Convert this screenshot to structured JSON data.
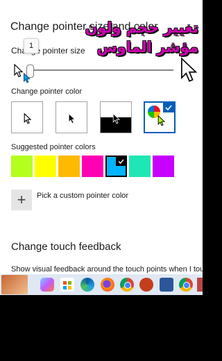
{
  "settings": {
    "heading": "Change pointer size and color",
    "overlay": {
      "line1": "تغيير حجم ولون",
      "line2": "مؤشر الماوس"
    },
    "size": {
      "label": "Change pointer size",
      "tooltip": "1",
      "value": 1,
      "min": 1,
      "max": 15
    },
    "color": {
      "label": "Change pointer color",
      "options": [
        "white",
        "black",
        "inverted",
        "custom"
      ],
      "selected": "custom"
    },
    "suggested": {
      "label": "Suggested pointer colors",
      "colors": [
        "#b4ff1e",
        "#ffff00",
        "#ffb900",
        "#ff00b4",
        "#00b4ff",
        "#1ee6b4",
        "#c800ff"
      ],
      "selected": "#00b4ff"
    },
    "custom": {
      "icon": "plus-icon",
      "glyph": "+",
      "label": "Pick a custom pointer color"
    },
    "touch": {
      "heading": "Change touch feedback",
      "description": "Show visual feedback around the touch points when I touch"
    }
  },
  "taskbar": {
    "icons": [
      "squirrel-wallpaper-icon",
      "copilot-icon",
      "microsoft-store-icon",
      "edge-icon",
      "firefox-icon",
      "chrome-icon",
      "powerpoint-icon",
      "word-icon",
      "chrome-profile-icon",
      "overflow-icon"
    ]
  }
}
